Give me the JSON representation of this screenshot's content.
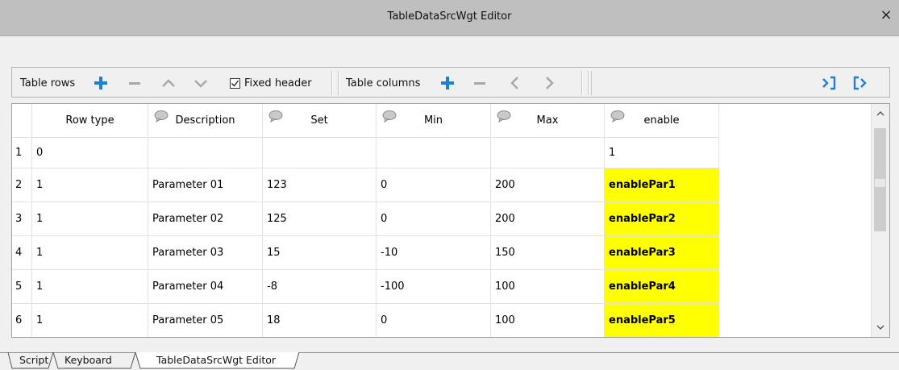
{
  "window": {
    "title": "TableDataSrcWgt Editor",
    "close_glyph": "×"
  },
  "toolbar": {
    "rows_label": "Table rows",
    "fixed_header_label": "Fixed header",
    "fixed_header_checked": true,
    "columns_label": "Table columns",
    "accent_color": "#1e7fd6",
    "icons": [
      "plus-icon",
      "minus-icon",
      "chevron-up-icon",
      "chevron-down-icon",
      "chevron-left-icon",
      "chevron-right-icon",
      "export-icon",
      "import-icon"
    ]
  },
  "table": {
    "columns": [
      "Row type",
      "Description",
      "Set",
      "Min",
      "Max",
      "enable"
    ],
    "header_icon": "comment-bubble-icon",
    "highlight_color": "#ffff00",
    "rows": [
      {
        "num": "1",
        "cells": [
          "0",
          "",
          "",
          "",
          "",
          "1"
        ]
      },
      {
        "num": "2",
        "cells": [
          "1",
          "Parameter 01",
          "123",
          "0",
          "200",
          "enablePar1"
        ]
      },
      {
        "num": "3",
        "cells": [
          "1",
          "Parameter 02",
          "125",
          "0",
          "200",
          "enablePar2"
        ]
      },
      {
        "num": "4",
        "cells": [
          "1",
          "Parameter 03",
          "15",
          "-10",
          "150",
          "enablePar3"
        ]
      },
      {
        "num": "5",
        "cells": [
          "1",
          "Parameter 04",
          "-8",
          "-100",
          "100",
          "enablePar4"
        ]
      },
      {
        "num": "6",
        "cells": [
          "1",
          "Parameter 05",
          "18",
          "0",
          "100",
          "enablePar5"
        ]
      }
    ]
  },
  "tabs": [
    {
      "label": "Script",
      "active": false
    },
    {
      "label": "Keyboard",
      "active": false
    },
    {
      "label": "TableDataSrcWgt Editor",
      "active": true
    }
  ]
}
